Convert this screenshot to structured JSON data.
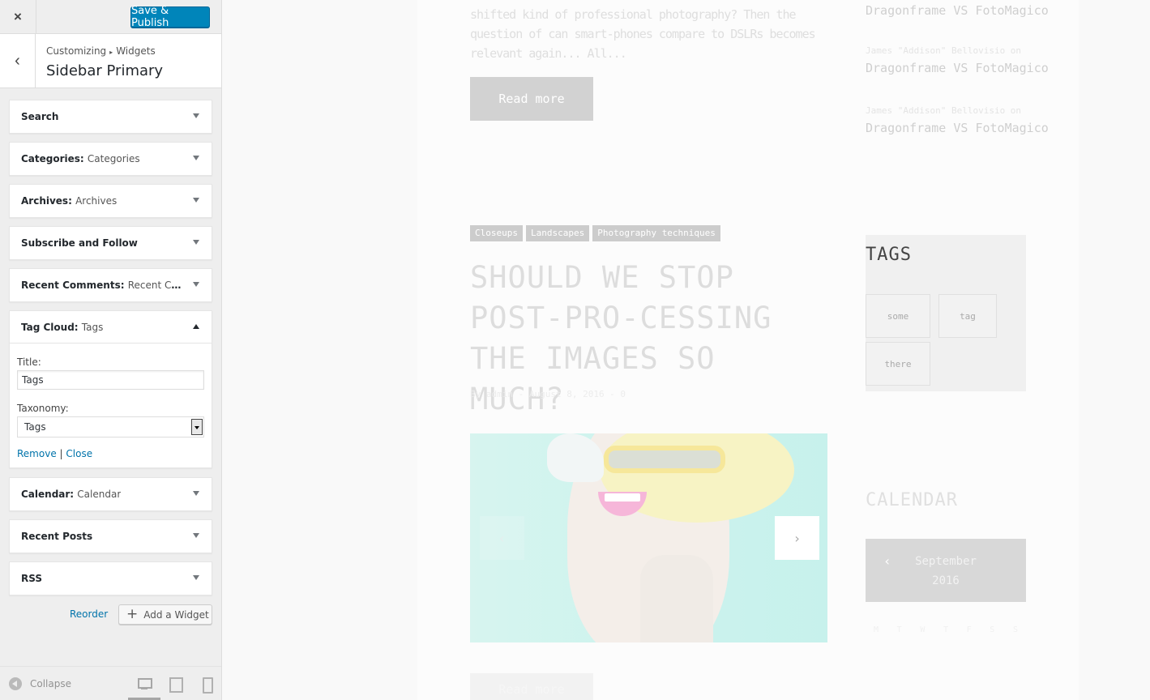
{
  "topbar": {
    "close_icon": "×",
    "publish_label": "Save & Publish"
  },
  "panel": {
    "back_icon": "‹",
    "breadcrumb_root": "Customizing",
    "breadcrumb_sep": "▸",
    "breadcrumb_child": "Widgets",
    "title": "Sidebar Primary"
  },
  "widgets": [
    {
      "name": "Search",
      "sub": ""
    },
    {
      "name": "Categories:",
      "sub": "Categories"
    },
    {
      "name": "Archives:",
      "sub": "Archives"
    },
    {
      "name": "Subscribe and Follow",
      "sub": ""
    },
    {
      "name": "Recent Comments:",
      "sub": "Recent Com..."
    },
    {
      "name": "Tag Cloud:",
      "sub": "Tags"
    },
    {
      "name": "Calendar:",
      "sub": "Calendar"
    },
    {
      "name": "Recent Posts",
      "sub": ""
    },
    {
      "name": "RSS",
      "sub": ""
    }
  ],
  "tag_cloud_form": {
    "title_label": "Title:",
    "title_value": "Tags",
    "taxonomy_label": "Taxonomy:",
    "taxonomy_value": "Tags",
    "remove_label": "Remove",
    "separator": "|",
    "close_label": "Close"
  },
  "actions": {
    "reorder_label": "Reorder",
    "add_widget_label": "Add a Widget",
    "add_icon": "+"
  },
  "footer": {
    "collapse_label": "Collapse"
  },
  "preview": {
    "excerpt": "shifted kind of professional photography? Then the question of can smart-phones compare to DSLRs becomes relevant again... All...",
    "read_more": "Read more",
    "recent_comments": [
      {
        "author": "",
        "link": "Dragonframe VS FotoMagico"
      },
      {
        "author": "James \"Addison\" Bellovisio on",
        "link": "Dragonframe VS FotoMagico"
      },
      {
        "author": "James \"Addison\" Bellovisio on",
        "link": "Dragonframe VS FotoMagico"
      }
    ],
    "categories": [
      "Closeups",
      "Landscapes",
      "Photography techniques"
    ],
    "post_title": "SHOULD WE STOP POST-PRO-CESSING THE IMAGES SO MUCH?",
    "meta": "By admin - August 8, 2016 - 0",
    "slider_prev_icon": "‹",
    "slider_next_icon": "›",
    "tags_title": "TAGS",
    "tags": [
      "some",
      "tag",
      "there"
    ],
    "calendar_title": "CALENDAR",
    "calendar_prev_icon": "‹",
    "calendar_month": "September",
    "calendar_year": "2016",
    "calendar_days": [
      "M",
      "T",
      "W",
      "T",
      "F",
      "S",
      "S"
    ]
  }
}
